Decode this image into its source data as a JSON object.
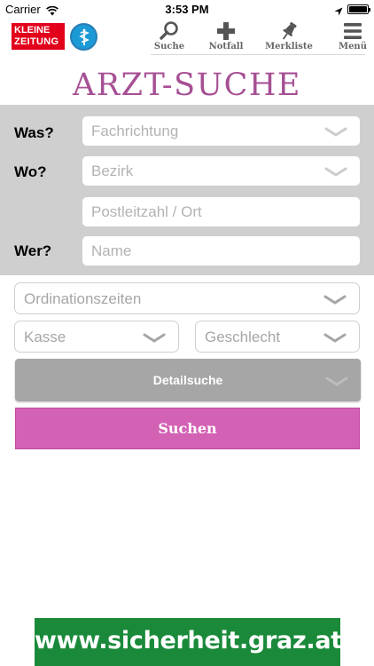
{
  "status_bar": {
    "carrier": "Carrier",
    "time": "3:53 PM",
    "battery_level": 1.0
  },
  "header": {
    "logo_line1": "KLEINE",
    "logo_line2": "ZEITUNG",
    "nav": [
      {
        "label": "Suche",
        "icon": "search-icon"
      },
      {
        "label": "Notfall",
        "icon": "plus-icon"
      },
      {
        "label": "Merkliste",
        "icon": "pin-icon"
      },
      {
        "label": "Menü",
        "icon": "hamburger-icon"
      }
    ]
  },
  "title": "ARZT-SUCHE",
  "search_form": {
    "was_label": "Was?",
    "fachrichtung_placeholder": "Fachrichtung",
    "wo_label": "Wo?",
    "bezirk_placeholder": "Bezirk",
    "plz_placeholder": "Postleitzahl / Ort",
    "wer_label": "Wer?",
    "name_placeholder": "Name"
  },
  "filters": {
    "ordinationszeiten": "Ordinationszeiten",
    "kasse": "Kasse",
    "geschlecht": "Geschlecht"
  },
  "detail_button": "Detailsuche",
  "search_button": "Suchen",
  "banner_text": "www.sicherheit.graz.at",
  "colors": {
    "title": "#a64f94",
    "search_button": "#d361b4",
    "panel": "#cfcfcf",
    "banner": "#1a8a3a",
    "logo": "#e2001a",
    "badge": "#1c9ad6"
  }
}
